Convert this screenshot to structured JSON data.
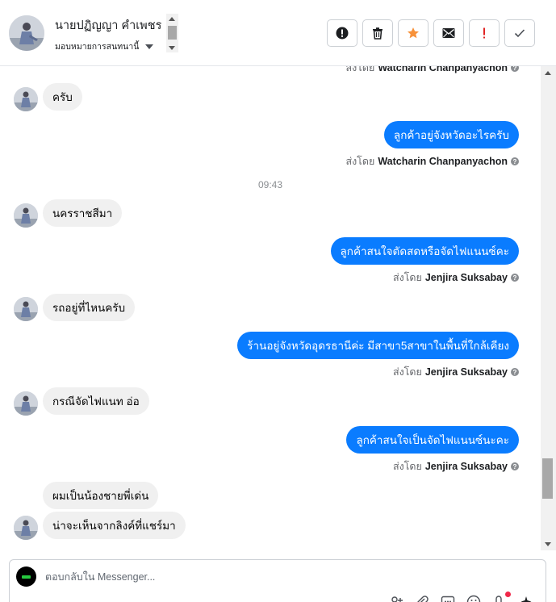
{
  "header": {
    "contact_name": "นายปฏิญญา คำเพชร",
    "assign_label": "มอบหมายการสนทนานี้",
    "toolbar_icons": [
      "alert-icon",
      "trash-icon",
      "star-icon",
      "mail-icon",
      "exclamation-icon",
      "check-icon"
    ],
    "colors": {
      "star": "#f7923b",
      "exclamation": "#e02424"
    }
  },
  "conversation": {
    "top_partial_sent_by": {
      "prefix": "ส่งโดย",
      "agent": "Watcharin Chanpanyachon"
    },
    "items": [
      {
        "type": "in",
        "text": "ครับ"
      },
      {
        "type": "out",
        "text": "ลูกค้าอยู่จังหวัดอะไรครับ",
        "sent_by_prefix": "ส่งโดย",
        "agent": "Watcharin Chanpanyachon"
      },
      {
        "type": "time",
        "text": "09:43"
      },
      {
        "type": "in",
        "text": "นครราชสีมา"
      },
      {
        "type": "out",
        "text": "ลูกค้าสนใจตัดสดหรือจัดไฟแนนซ์คะ",
        "sent_by_prefix": "ส่งโดย",
        "agent": "Jenjira Suksabay"
      },
      {
        "type": "in",
        "text": "รถอยู่ที่ไหนครับ"
      },
      {
        "type": "out",
        "text": "ร้านอยู่จังหวัดอุดรธานีค่ะ มีสาขา5สาขาในพื้นที่ใกล้เคียง",
        "sent_by_prefix": "ส่งโดย",
        "agent": "Jenjira Suksabay"
      },
      {
        "type": "in",
        "text": "กรณีจัดไฟแนท  อ่อ"
      },
      {
        "type": "out",
        "text": "ลูกค้าสนใจเป็นจัดไฟแนนซ์นะคะ",
        "sent_by_prefix": "ส่งโดย",
        "agent": "Jenjira Suksabay"
      },
      {
        "type": "in",
        "text": "ผมเป็นน้องชายพี่เด่น"
      },
      {
        "type": "in",
        "text": "น่าจะเห็นจากลิงค์ที่แชร์มา"
      }
    ],
    "colors": {
      "outgoing_bubble": "#0a7cff",
      "incoming_bubble": "#f0f0f0"
    }
  },
  "composer": {
    "placeholder": "ตอบกลับใน Messenger...",
    "tool_icons": [
      "add-person-icon",
      "attachment-icon",
      "saved-reply-icon",
      "emoji-icon",
      "appointment-icon",
      "sparkle-icon"
    ]
  }
}
